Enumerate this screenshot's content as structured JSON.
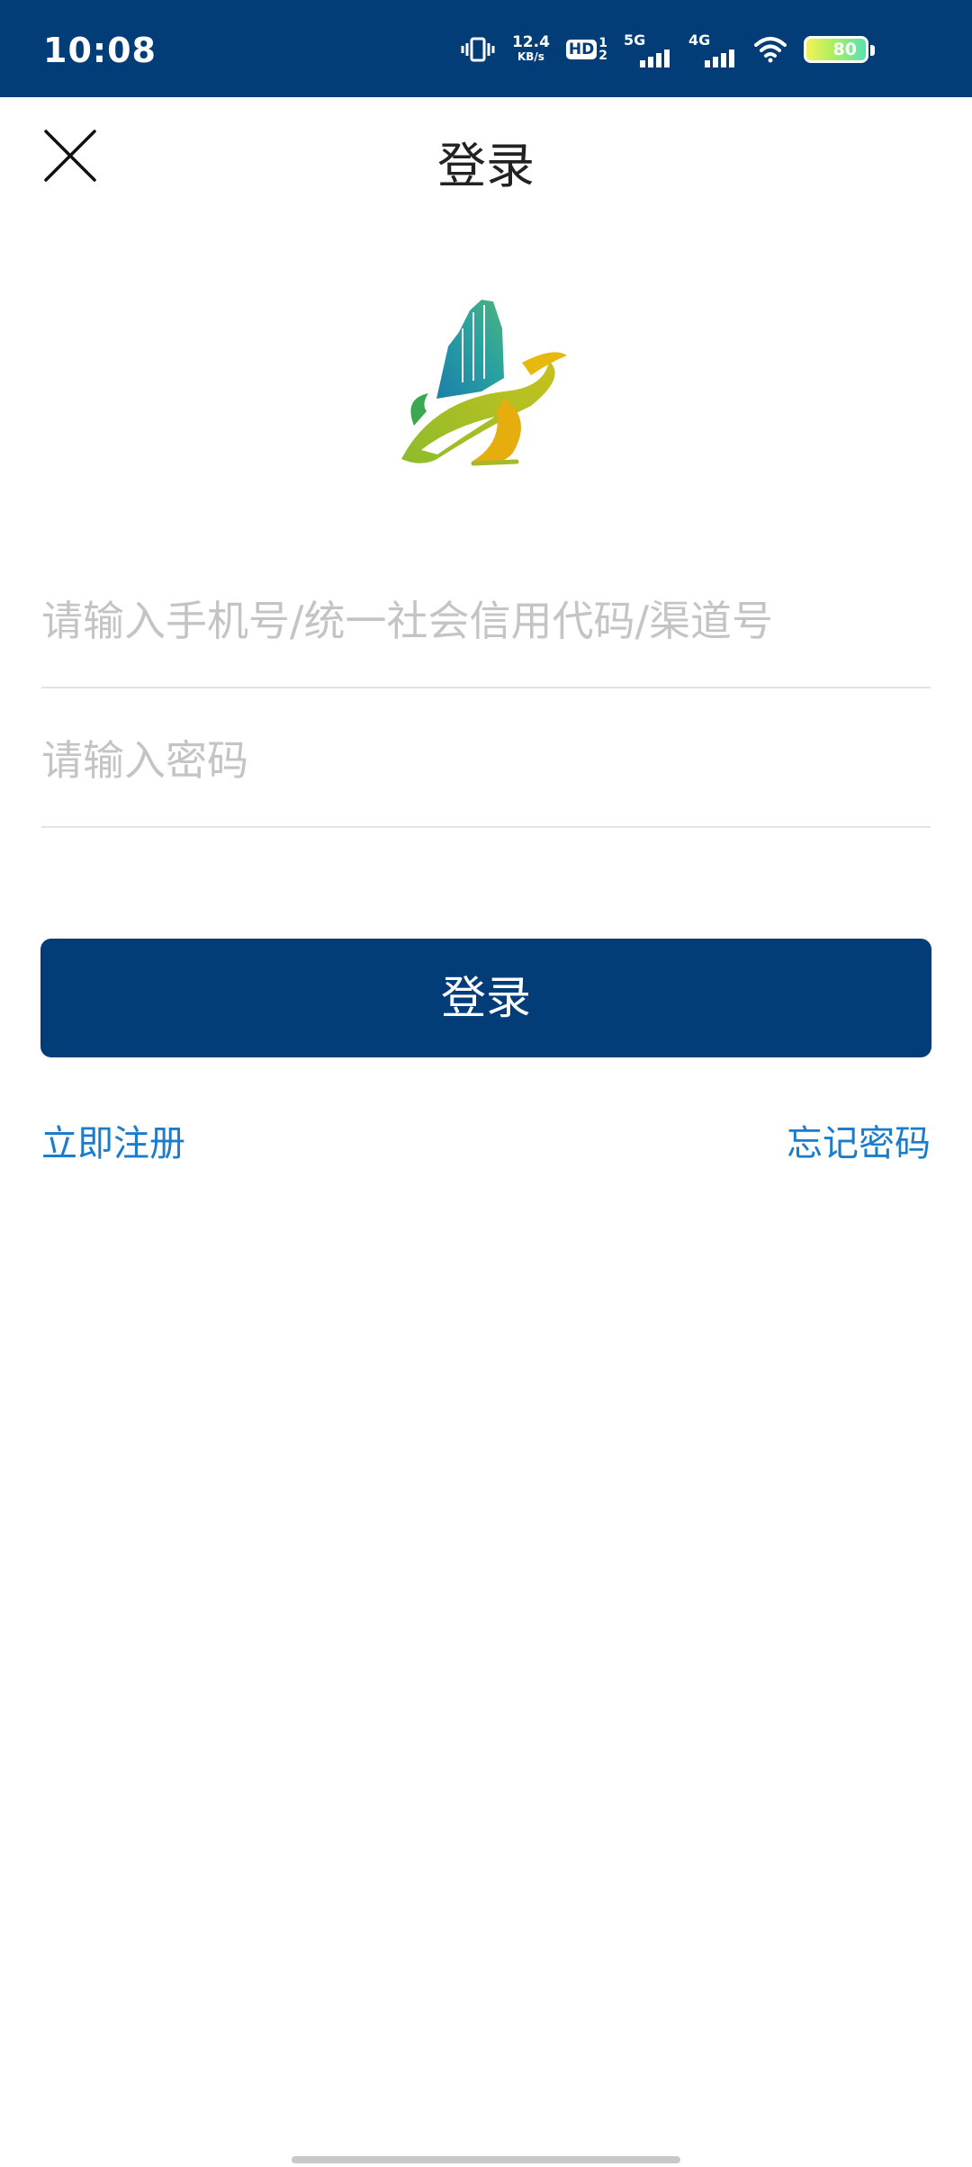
{
  "status_bar": {
    "time": "10:08",
    "net_speed_value": "12.4",
    "net_speed_unit": "KB/s",
    "hd_label": "HD",
    "hd_sup": "1",
    "hd_sub": "2",
    "signal_5g": "5G",
    "signal_4g": "4G",
    "battery": "80",
    "icons": [
      "vibrate-icon",
      "hd-icon",
      "signal-5g-icon",
      "signal-4g-icon",
      "wifi-icon",
      "battery-icon"
    ]
  },
  "header": {
    "title": "登录",
    "close_icon": "close-icon"
  },
  "logo": {
    "icon": "app-logo-icon"
  },
  "form": {
    "account_placeholder": "请输入手机号/统一社会信用代码/渠道号",
    "account_value": "",
    "password_placeholder": "请输入密码",
    "password_value": "",
    "login_label": "登录",
    "register_label": "立即注册",
    "forgot_label": "忘记密码"
  },
  "colors": {
    "primary": "#023d78",
    "link": "#1a7ccb",
    "placeholder": "#c4c4c4",
    "divider": "#e4e4e4"
  }
}
